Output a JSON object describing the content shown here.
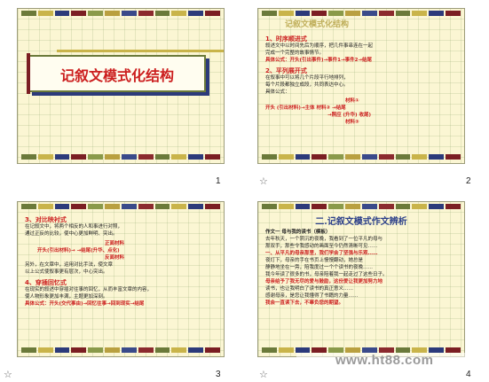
{
  "slides": [
    {
      "number": "1",
      "title": "记叙文模式化结构"
    },
    {
      "number": "2",
      "heading_faint": "记叙文模式化结构",
      "sections": [
        {
          "label": "1、时序顺进式",
          "lines": [
            "叙述文中以时间先后为顺序，把几件事串连在一起",
            "完成一个完整的故事情节。",
            "具体公式：开头(引出事件)→事件1→事件2→结尾"
          ]
        },
        {
          "label": "2、平列展开式",
          "lines": [
            "在叙事中可以将几个片段平行地排列，",
            "每个片段都独立成段，共同表达中心。",
            "具体公式："
          ]
        }
      ],
      "formula": [
        "材料①",
        "开头 (引出材料)→主体  材料②  →结尾",
        "→照应 (升华)  收尾)",
        "材料③"
      ]
    },
    {
      "number": "3",
      "sections": [
        {
          "label": "3、对比映衬式",
          "lines": [
            "在记叙文中，将两个相反的人和事进行对照，",
            "通过正反的比较，使中心更加鲜明、突出。"
          ]
        },
        {
          "label": "",
          "lines": [
            "正面材料",
            "开头(引出材料)→       →结尾(升华、点化)",
            "反面材料",
            "另外，在文章中，运用对比手法，使文章",
            "以上公式使叙事更有层次，中心突出。"
          ]
        },
        {
          "label": "4、穿插回忆式",
          "lines": [
            "在现实的叙述中穿插对往事的回忆，从而丰富文章的内容，",
            "使人物形象更加丰满，主题更加深刻。",
            "具体公式：开头(交代事由)→回忆往事→回到现实→结尾"
          ]
        }
      ]
    },
    {
      "number": "4",
      "title": "二.记叙文模式作文辨析",
      "lines": [
        "作文一        母与我的读书（模板）",
        "  去年秋天，一个阴沉的夜晚，我看到了一位平凡的母与",
        "那双手，那些令我感动的画面至今仍然清晰可见……",
        "  一、从平凡的母亲那里，我们学会了坚强与乐观……",
        "  夜灯下，母亲的手在书页上慢慢翻动，她总是",
        "  静静地坐在一旁，陪我度过一个个读书的夜晚……",
        "  我今年读了很多的书，母亲陪着我一起走过了这些日子。",
        "  母亲给予了我无尽的爱与鼓励，这份爱让我更加努力地",
        "  读书，也让我明白了读书的真正意义……",
        "  感谢母亲，是您让我懂得了书籍的力量……",
        "  我会一直读下去，不辜负您的期望。"
      ]
    }
  ],
  "watermark": "www.ht88.com",
  "colors": {
    "slide_bg": "#fbf6d3",
    "accent_red": "#cc1f1f",
    "accent_blue": "#2b3f8a",
    "bar_colors": [
      "#6b7a3a",
      "#c9b44a",
      "#2c3a7a",
      "#7b1e23",
      "#8a9a4a",
      "#b9a040",
      "#3a4a8a",
      "#8b2a2e"
    ]
  }
}
